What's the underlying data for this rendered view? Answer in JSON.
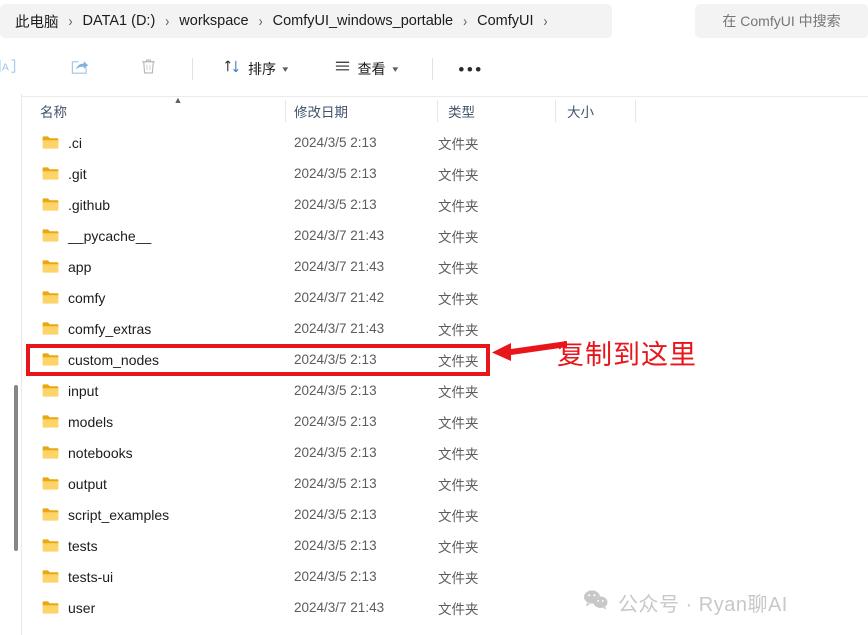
{
  "window": {
    "title": "ComfyUI"
  },
  "address": {
    "breadcrumbs": [
      {
        "label": "此电脑"
      },
      {
        "label": "DATA1 (D:)"
      },
      {
        "label": "workspace"
      },
      {
        "label": "ComfyUI_windows_portable"
      },
      {
        "label": "ComfyUI"
      }
    ],
    "separator": "›",
    "search_placeholder": "在 ComfyUI 中搜索"
  },
  "toolbar": {
    "icons": [
      {
        "name": "rename-icon",
        "glyph": "A"
      },
      {
        "name": "share-icon",
        "glyph": "share"
      },
      {
        "name": "delete-icon",
        "glyph": "trash"
      }
    ],
    "sort_label": "排序",
    "view_label": "查看",
    "more_label": "•••",
    "caret": "⌄"
  },
  "columns": {
    "name": "名称",
    "date_modified": "修改日期",
    "type": "类型",
    "size": "大小",
    "sort_indicator": "▲",
    "sorted_by": "名称",
    "sort_direction": "ascending"
  },
  "files": [
    {
      "name": ".ci",
      "date": "2024/3/5 2:13",
      "type": "文件夹",
      "size": "",
      "selected": false
    },
    {
      "name": ".git",
      "date": "2024/3/5 2:13",
      "type": "文件夹",
      "size": "",
      "selected": false
    },
    {
      "name": ".github",
      "date": "2024/3/5 2:13",
      "type": "文件夹",
      "size": "",
      "selected": false
    },
    {
      "name": "__pycache__",
      "date": "2024/3/7 21:43",
      "type": "文件夹",
      "size": "",
      "selected": false
    },
    {
      "name": "app",
      "date": "2024/3/7 21:43",
      "type": "文件夹",
      "size": "",
      "selected": false
    },
    {
      "name": "comfy",
      "date": "2024/3/7 21:42",
      "type": "文件夹",
      "size": "",
      "selected": false
    },
    {
      "name": "comfy_extras",
      "date": "2024/3/7 21:43",
      "type": "文件夹",
      "size": "",
      "selected": false
    },
    {
      "name": "custom_nodes",
      "date": "2024/3/5 2:13",
      "type": "文件夹",
      "size": "",
      "selected": true
    },
    {
      "name": "input",
      "date": "2024/3/5 2:13",
      "type": "文件夹",
      "size": "",
      "selected": false
    },
    {
      "name": "models",
      "date": "2024/3/5 2:13",
      "type": "文件夹",
      "size": "",
      "selected": false
    },
    {
      "name": "notebooks",
      "date": "2024/3/5 2:13",
      "type": "文件夹",
      "size": "",
      "selected": false
    },
    {
      "name": "output",
      "date": "2024/3/5 2:13",
      "type": "文件夹",
      "size": "",
      "selected": false
    },
    {
      "name": "script_examples",
      "date": "2024/3/5 2:13",
      "type": "文件夹",
      "size": "",
      "selected": false
    },
    {
      "name": "tests",
      "date": "2024/3/5 2:13",
      "type": "文件夹",
      "size": "",
      "selected": false
    },
    {
      "name": "tests-ui",
      "date": "2024/3/5 2:13",
      "type": "文件夹",
      "size": "",
      "selected": false
    },
    {
      "name": "user",
      "date": "2024/3/7 21:43",
      "type": "文件夹",
      "size": "",
      "selected": false
    }
  ],
  "annotation": {
    "text": "复制到这里",
    "color": "#e8151b",
    "target_row": "custom_nodes"
  },
  "watermark": {
    "text": "公众号 · Ryan聊AI",
    "icon": "wechat-icon",
    "color": "#c8c8c8"
  }
}
